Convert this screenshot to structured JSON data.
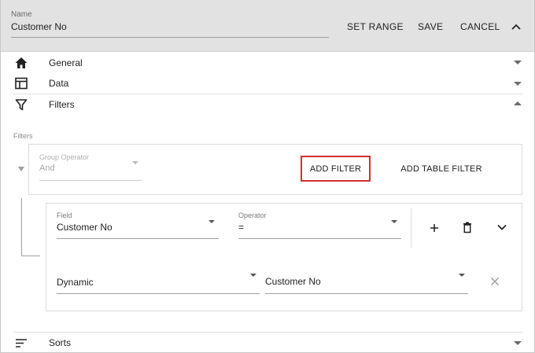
{
  "header": {
    "name_label": "Name",
    "name_value": "Customer No",
    "set_range": "SET RANGE",
    "save": "SAVE",
    "cancel": "CANCEL"
  },
  "sections": {
    "general": "General",
    "data": "Data",
    "filters": "Filters",
    "sorts": "Sorts"
  },
  "filters": {
    "caption": "Filters",
    "group_operator_label": "Group Operator",
    "group_operator_value": "And",
    "add_filter": "ADD FILTER",
    "add_table_filter": "ADD TABLE FILTER",
    "field_label": "Field",
    "field_value": "Customer No",
    "operator_label": "Operator",
    "operator_value": "=",
    "value_type": "Dynamic",
    "value": "Customer No"
  },
  "colors": {
    "header_bg": "#e2e2e2",
    "highlight_border": "#d32f2f"
  }
}
